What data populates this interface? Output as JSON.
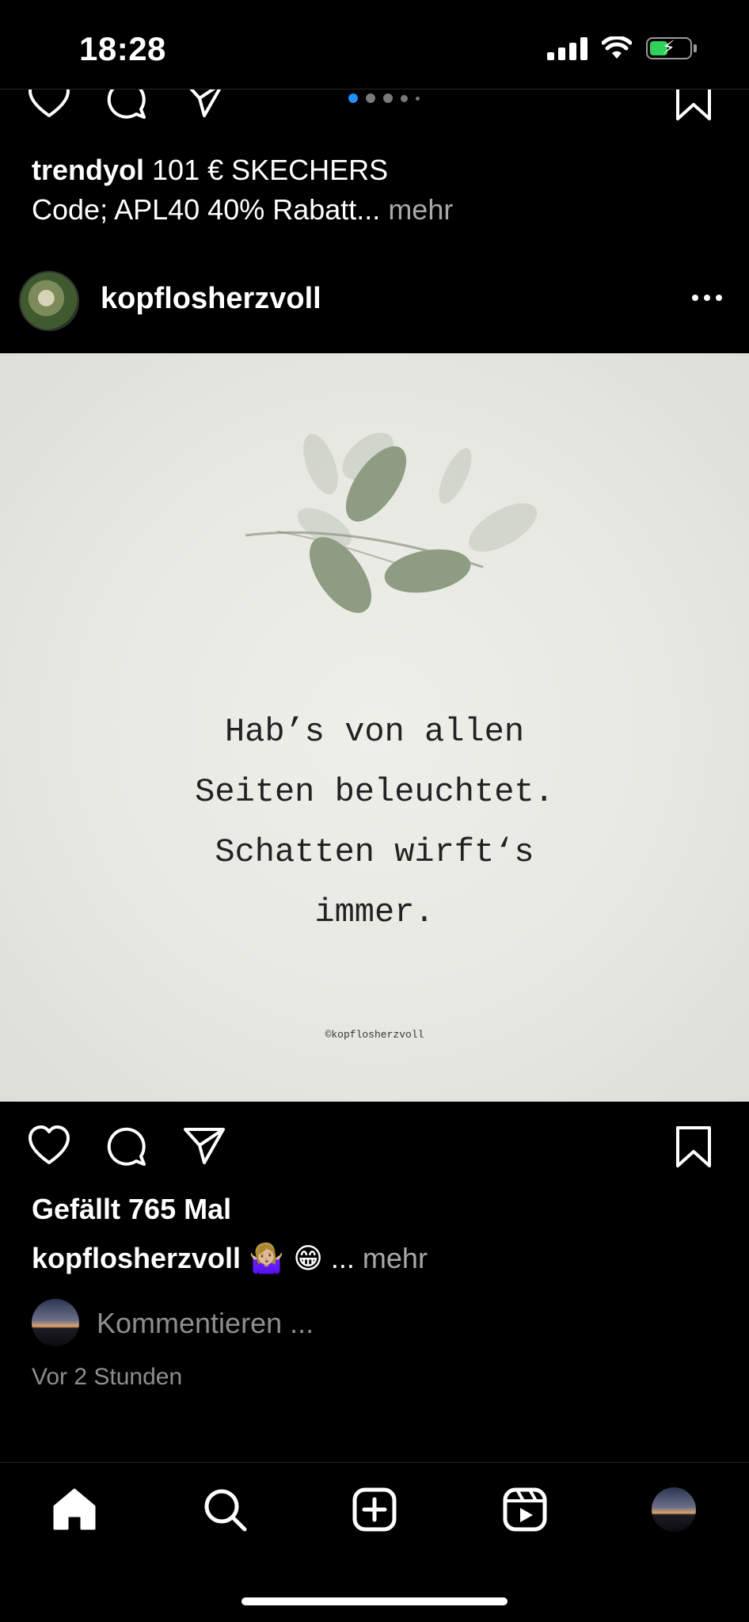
{
  "status_bar": {
    "time": "18:28",
    "battery_color": "#30d158"
  },
  "previous_post": {
    "carousel": {
      "count": 5,
      "active_index": 0,
      "active_color": "#1e90ff"
    },
    "caption": {
      "username": "trendyol",
      "text_line1": "101 € SKECHERS",
      "text_line2": "Code; APL40 40% Rabatt...",
      "more": "mehr"
    }
  },
  "post": {
    "username": "kopflosherzvoll",
    "image": {
      "quote_lines": [
        "Hab’s von allen",
        "Seiten beleuchtet.",
        "Schatten wirft‘s",
        "immer."
      ],
      "handle": "©kopflosherzvoll"
    },
    "likes": "Gefällt 765 Mal",
    "caption": {
      "username": "kopflosherzvoll",
      "emojis": "🤷🏼‍♀️ 😁",
      "ellipsis": "...",
      "more": "mehr"
    },
    "comment_placeholder": "Kommentieren ...",
    "timestamp": "Vor 2 Stunden"
  },
  "icons": {
    "like": "heart-icon",
    "comment": "comment-bubble-icon",
    "share": "paper-plane-icon",
    "save": "bookmark-icon",
    "more": "more-dots-icon"
  },
  "tab_bar": [
    "home-icon",
    "search-icon",
    "create-icon",
    "reels-icon",
    "profile-avatar"
  ]
}
